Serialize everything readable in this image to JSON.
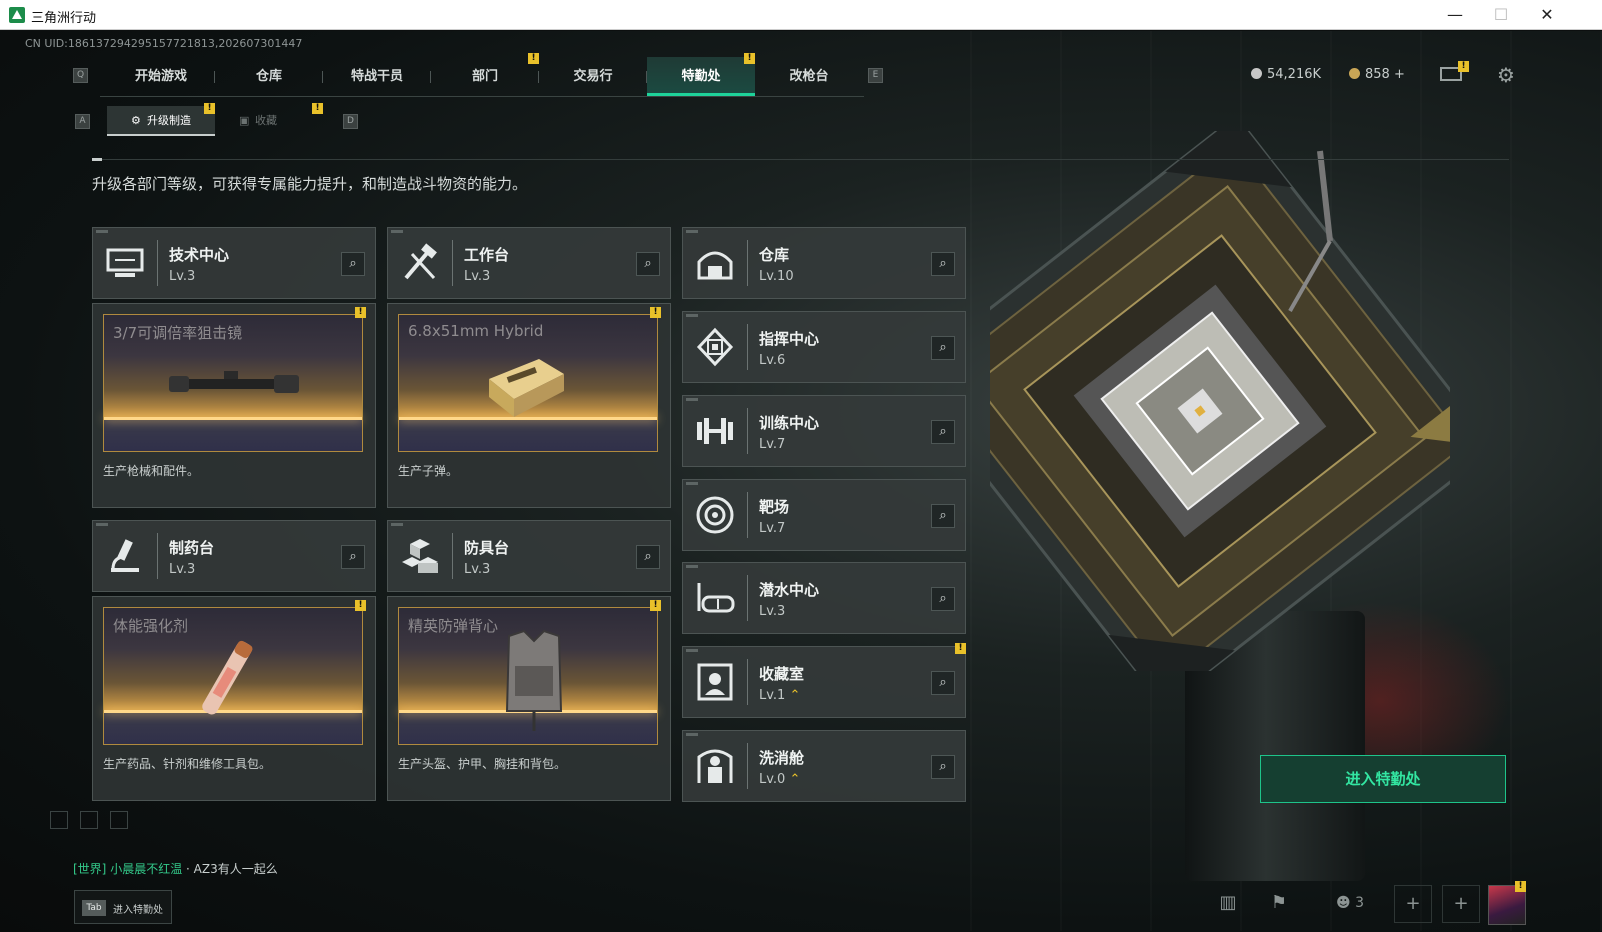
{
  "window": {
    "title": "三角洲行动",
    "minimize": "—",
    "maximize": "☐",
    "close": "✕"
  },
  "uid": "CN UID:18613729429515772181​3,20260730144​7",
  "nav": {
    "key_left": "Q",
    "key_right": "E",
    "tabs": [
      {
        "label": "开始游戏",
        "badge": ""
      },
      {
        "label": "仓库",
        "badge": ""
      },
      {
        "label": "特战干员",
        "badge": ""
      },
      {
        "label": "部门",
        "badge": "!"
      },
      {
        "label": "交易行",
        "badge": ""
      },
      {
        "label": "特勤处",
        "badge": "!"
      },
      {
        "label": "改枪台",
        "badge": ""
      }
    ]
  },
  "subnav": {
    "key_left": "A",
    "key_right": "D",
    "items": [
      {
        "label": "升级制造"
      },
      {
        "label": "收藏"
      }
    ]
  },
  "currency": {
    "silver": "54,216K",
    "gold": "858",
    "plus": "+"
  },
  "description": "升级各部门等级，可获得专属能力提升，和制造战斗物资的能力。",
  "departments": [
    {
      "name": "技术中心",
      "level": "Lv.3",
      "icon": "computer-icon"
    },
    {
      "name": "工作台",
      "level": "Lv.3",
      "icon": "tools-icon"
    },
    {
      "name": "制药台",
      "level": "Lv.3",
      "icon": "microscope-icon"
    },
    {
      "name": "防具台",
      "level": "Lv.3",
      "icon": "armor-blocks-icon"
    },
    {
      "name": "仓库",
      "level": "Lv.10",
      "icon": "warehouse-icon"
    },
    {
      "name": "指挥中心",
      "level": "Lv.6",
      "icon": "command-chip-icon"
    },
    {
      "name": "训练中心",
      "level": "Lv.7",
      "icon": "dumbbell-icon"
    },
    {
      "name": "靶场",
      "level": "Lv.7",
      "icon": "target-icon"
    },
    {
      "name": "潜水中心",
      "level": "Lv.3",
      "icon": "diving-mask-icon"
    },
    {
      "name": "收藏室",
      "level": "Lv.1",
      "icon": "bust-icon"
    },
    {
      "name": "洗消舱",
      "level": "Lv.0",
      "icon": "hazmat-icon"
    }
  ],
  "products": [
    {
      "item": "3/7可调倍率狙击镜",
      "text": "生产枪械和配件。"
    },
    {
      "item": "6.8x51mm Hybrid",
      "text": "生产子弹。"
    },
    {
      "item": "体能强化剂",
      "text": "生产药品、针剂和维修工具包。"
    },
    {
      "item": "精英防弹背心",
      "text": "生产头盔、护甲、胸挂和背包。"
    }
  ],
  "enter_button": "进入特勤处",
  "chat": {
    "channel": "[世界]",
    "user": "小晨晨不红温",
    "message": "·  AZ3有人一起么"
  },
  "tab_hint": {
    "key": "Tab",
    "label": "进入特勤处"
  },
  "bottom_bar": {
    "friends_count": "3"
  },
  "colors": {
    "accent": "#1ed39a",
    "badge": "#e9c12a",
    "product_glow": "#d29d47"
  }
}
